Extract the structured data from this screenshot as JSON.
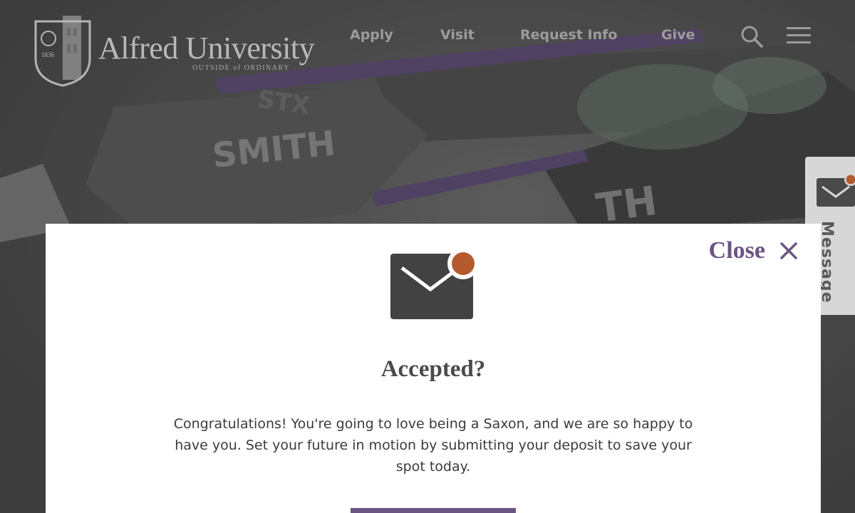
{
  "brand": {
    "name": "Alfred University",
    "tagline": "OUTSIDE of ORDINARY",
    "seal_year": "1836"
  },
  "nav": {
    "items": [
      {
        "label": "Apply"
      },
      {
        "label": "Visit"
      },
      {
        "label": "Request Info"
      },
      {
        "label": "Give"
      }
    ]
  },
  "hero": {
    "stick_text_1": "SMITH",
    "stick_text_2": "TH",
    "stick_text_3": "STX"
  },
  "side_tab": {
    "label": "Message",
    "icon": "envelope-notification-icon"
  },
  "modal": {
    "close_label": "Close",
    "icon": "envelope-notification-icon",
    "title": "Accepted?",
    "body": "Congratulations! You're going to love being a Saxon, and we are so happy to have you. Set your future in motion by submitting your deposit to save your spot today."
  },
  "colors": {
    "accent_purple": "#6a5583",
    "notification_dot": "#b5592e",
    "envelope": "#424242"
  }
}
